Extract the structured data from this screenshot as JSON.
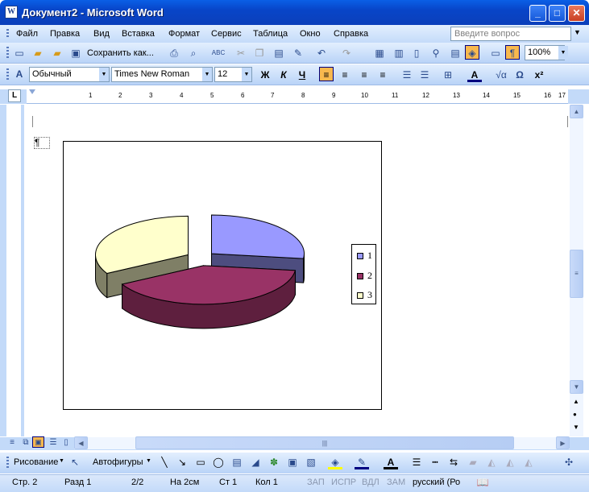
{
  "window": {
    "title": "Документ2 - Microsoft Word",
    "app_icon": "W"
  },
  "menu": {
    "items": [
      "Файл",
      "Правка",
      "Вид",
      "Вставка",
      "Формат",
      "Сервис",
      "Таблица",
      "Окно",
      "Справка"
    ],
    "help_placeholder": "Введите вопрос"
  },
  "toolbar_standard": {
    "save_as_label": "Сохранить как...",
    "zoom": "100%"
  },
  "toolbar_format": {
    "style": "Обычный",
    "font": "Times New Roman",
    "size": "12",
    "bold": "Ж",
    "italic": "К",
    "underline": "Ч"
  },
  "ruler": {
    "labels": [
      "1",
      "2",
      "3",
      "4",
      "5",
      "6",
      "7",
      "8",
      "9",
      "10",
      "11",
      "12",
      "13",
      "14",
      "15",
      "16",
      "17"
    ]
  },
  "chart_data": {
    "type": "pie",
    "categories": [
      "1",
      "2",
      "3"
    ],
    "values": [
      27,
      40,
      33
    ],
    "colors": [
      "#9999ff",
      "#993366",
      "#ffffcc"
    ],
    "side_colors": [
      "#4d4d7f",
      "#5e1f3e",
      "#7f7f66"
    ],
    "legend": "right"
  },
  "drawing_toolbar": {
    "draw_label": "Рисование",
    "autoshapes_label": "Автофигуры"
  },
  "status": {
    "page": "Стр. 2",
    "section": "Разд 1",
    "pages": "2/2",
    "at": "На 2см",
    "line": "Ст 1",
    "col": "Кол 1",
    "rec": "ЗАП",
    "trk": "ИСПР",
    "ext": "ВДЛ",
    "ovr": "ЗАМ",
    "lang": "русский (Ро"
  }
}
